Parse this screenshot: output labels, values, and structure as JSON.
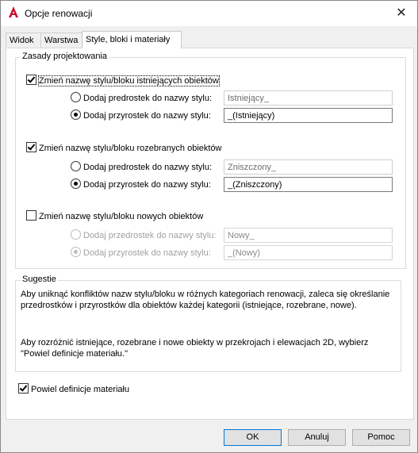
{
  "window": {
    "title": "Opcje renowacji",
    "close_glyph": "✕"
  },
  "tabs": [
    {
      "label": "Widok"
    },
    {
      "label": "Warstwa"
    },
    {
      "label": "Style, bloki i materiały"
    }
  ],
  "design_rules": {
    "legend": "Zasady projektowania",
    "existing": {
      "label": "Zmień nazwę stylu/bloku istniejących obiektów",
      "checked": true,
      "prefix_label": "Dodaj predrostek do nazwy stylu:",
      "prefix_value": "Istniejący_",
      "suffix_label": "Dodaj przyrostek do nazwy stylu:",
      "suffix_value": "_(Istniejący)"
    },
    "demolished": {
      "label": "Zmień nazwę stylu/bloku rozebranych obiektów",
      "checked": true,
      "prefix_label": "Dodaj predrostek do nazwy stylu:",
      "prefix_value": "Zniszczony_",
      "suffix_label": "Dodaj przyrostek do nazwy stylu:",
      "suffix_value": "_(Zniszczony)"
    },
    "new": {
      "label": "Zmień nazwę stylu/bloku nowych obiektów",
      "checked": false,
      "prefix_label": "Dodaj przedrostek do nazwy stylu:",
      "prefix_value": "Nowy_",
      "suffix_label": "Dodaj przyrostek do nazwy stylu:",
      "suffix_value": "_(Nowy)"
    }
  },
  "hints": {
    "legend": "Sugestie",
    "line1": "Aby uniknąć konfliktów nazw stylu/bloku w różnych kategoriach renowacji, zaleca się określanie",
    "line2": "przedrostków i przyrostków dla obiektów każdej kategorii (istniejące, rozebrane, nowe).",
    "line3": "Aby rozróżnić istniejące, rozebrane i nowe obiekty w przekrojach i elewacjach 2D, wybierz",
    "line4": "\"Powiel definicje materiału.\""
  },
  "duplicate_material": {
    "label": "Powiel definicje materiału",
    "checked": true
  },
  "buttons": {
    "ok": "OK",
    "cancel": "Anuluj",
    "help": "Pomoc"
  },
  "colors": {
    "app_icon": "#c8102e",
    "accent": "#0078d7"
  }
}
